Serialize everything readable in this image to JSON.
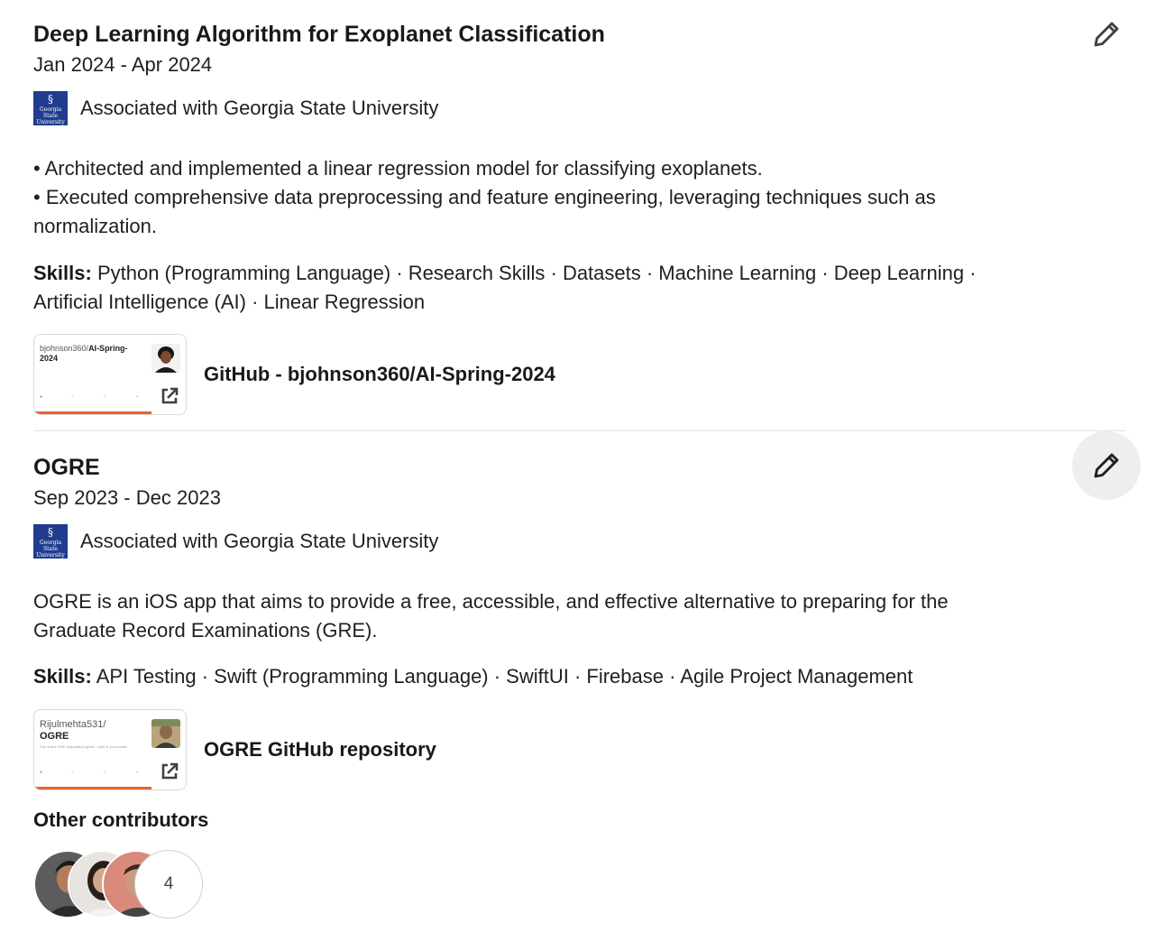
{
  "projects": [
    {
      "title": "Deep Learning Algorithm for Exoplanet Classification",
      "dates": "Jan 2024 - Apr 2024",
      "association": "Associated with Georgia State University",
      "logo_text": "Georgia State University",
      "description": [
        "• Architected and implemented a linear regression model for classifying exoplanets.",
        "• Executed comprehensive data preprocessing and feature engineering, leveraging techniques such as normalization."
      ],
      "skills_label": "Skills:",
      "skills": "Python (Programming Language) · Research Skills · Datasets · Machine Learning · Deep Learning · Artificial Intelligence (AI) · Linear Regression",
      "media": {
        "thumb_owner": "bjohnson360/",
        "thumb_repo": "AI-Spring-2024",
        "title": "GitHub - bjohnson360/AI-Spring-2024"
      }
    },
    {
      "title": "OGRE",
      "dates": "Sep 2023 - Dec 2023",
      "association": "Associated with Georgia State University",
      "logo_text": "Georgia State University",
      "description": [
        "OGRE is an iOS app that aims to provide a free, accessible, and effective alternative to preparing for the Graduate Record Examinations (GRE)."
      ],
      "skills_label": "Skills:",
      "skills": "API Testing · Swift (Programming Language) · SwiftUI · Firebase · Agile Project Management",
      "media": {
        "thumb_owner": "Rijulmehta531/",
        "thumb_repo": "OGRE",
        "thumb_desc": "The online GRE preparation guide - right in your hands",
        "title": "OGRE GitHub repository"
      },
      "contributors_label": "Other contributors",
      "contributors_more": "4"
    }
  ],
  "icons": {
    "edit": "pencil-icon",
    "external": "external-link-icon",
    "logo": "georgia-state-university-logo"
  },
  "colors": {
    "gsu_blue": "#1f3c8f",
    "github_bar": "#e8622c",
    "hover_bg": "#eeeeee"
  }
}
